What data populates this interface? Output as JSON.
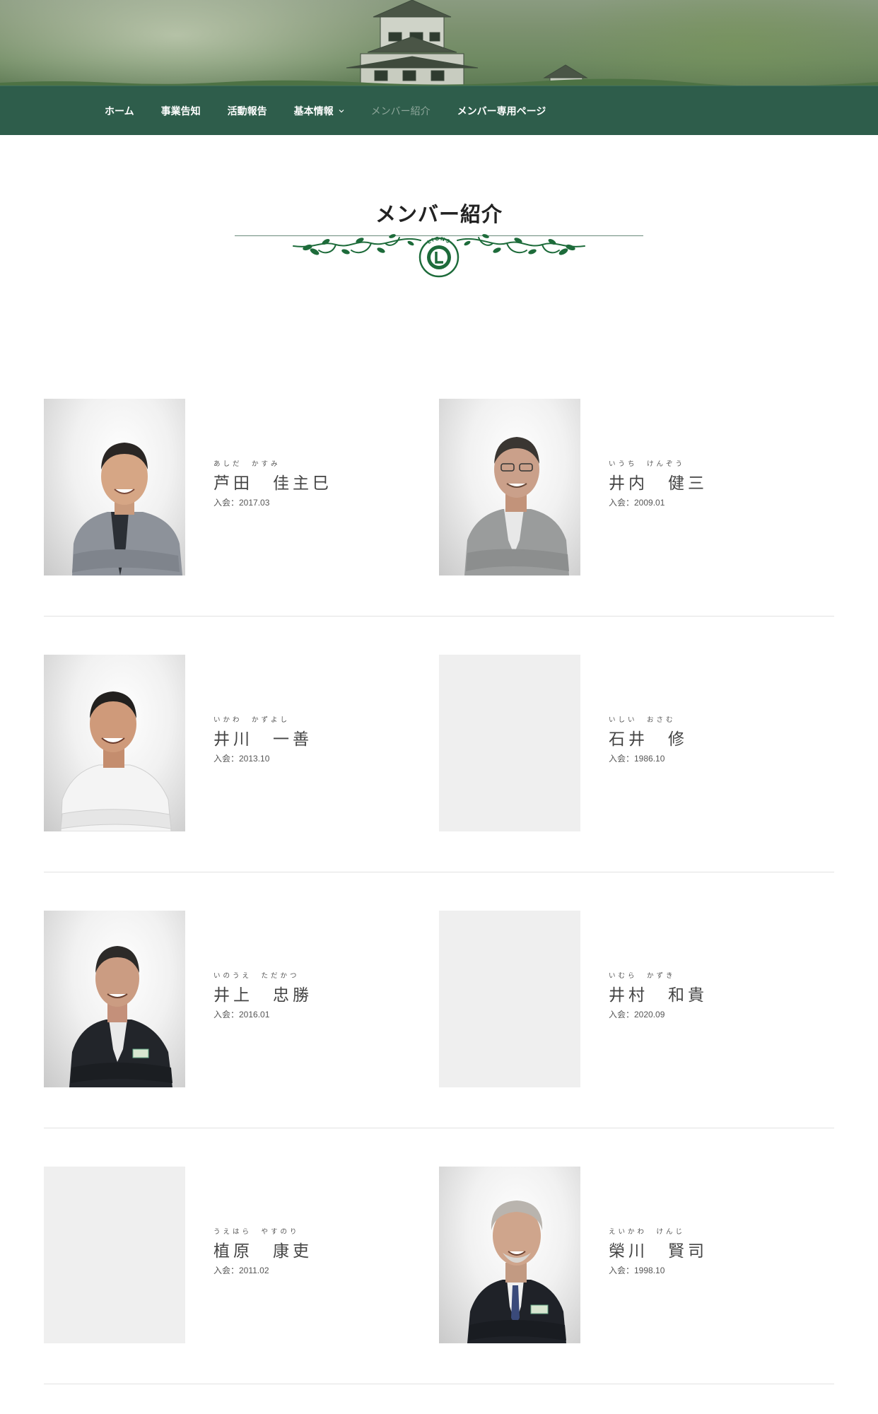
{
  "nav": {
    "items": [
      {
        "label": "ホーム"
      },
      {
        "label": "事業告知"
      },
      {
        "label": "活動報告"
      },
      {
        "label": "基本情報"
      },
      {
        "label": "メンバー紹介"
      },
      {
        "label": "メンバー専用ページ"
      }
    ],
    "active_index": 4
  },
  "page": {
    "title": "メンバー紹介",
    "emblem_text": "LIONS"
  },
  "members": [
    {
      "furigana": "あしだ　かすみ",
      "name": "芦田　佳主巳",
      "joined": "入会：2017.03",
      "has_photo": true
    },
    {
      "furigana": "いうち　けんぞう",
      "name": "井内　健三",
      "joined": "入会：2009.01",
      "has_photo": true
    },
    {
      "furigana": "いかわ　かずよし",
      "name": "井川　一善",
      "joined": "入会：2013.10",
      "has_photo": true
    },
    {
      "furigana": "いしい　おさむ",
      "name": "石井　修",
      "joined": "入会：1986.10",
      "has_photo": false
    },
    {
      "furigana": "いのうえ　ただかつ",
      "name": "井上　忠勝",
      "joined": "入会：2016.01",
      "has_photo": true
    },
    {
      "furigana": "いむら　かずき",
      "name": "井村　和貴",
      "joined": "入会：2020.09",
      "has_photo": false
    },
    {
      "furigana": "うえはら　やすのり",
      "name": "植原　康吏",
      "joined": "入会：2011.02",
      "has_photo": false
    },
    {
      "furigana": "えいかわ　けんじ",
      "name": "榮川　賢司",
      "joined": "入会：1998.10",
      "has_photo": true
    }
  ],
  "colors": {
    "nav_bg": "#2e5d4b",
    "nav_text": "#ffffff",
    "nav_active": "#8ea79b",
    "ornament_green": "#1d6b3a",
    "divider": "#e2e2e2",
    "placeholder": "#efefef"
  }
}
